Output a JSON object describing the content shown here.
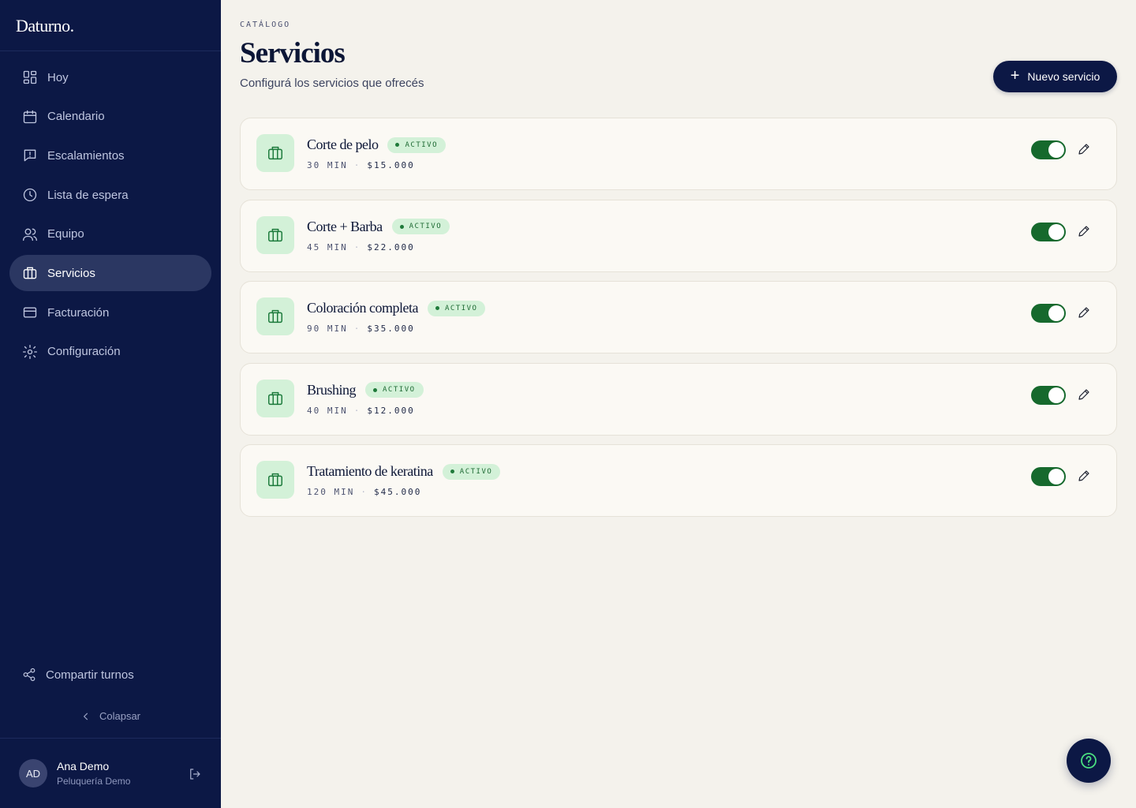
{
  "app": {
    "logo": "Daturno."
  },
  "sidebar": {
    "items": [
      {
        "label": "Hoy",
        "icon": "grid-icon",
        "active": false
      },
      {
        "label": "Calendario",
        "icon": "calendar-icon",
        "active": false
      },
      {
        "label": "Escalamientos",
        "icon": "message-alert-icon",
        "active": false
      },
      {
        "label": "Lista de espera",
        "icon": "clock-icon",
        "active": false
      },
      {
        "label": "Equipo",
        "icon": "users-icon",
        "active": false
      },
      {
        "label": "Servicios",
        "icon": "briefcase-icon",
        "active": true
      },
      {
        "label": "Facturación",
        "icon": "credit-card-icon",
        "active": false
      },
      {
        "label": "Configuración",
        "icon": "gear-icon",
        "active": false
      }
    ],
    "share_label": "Compartir turnos",
    "collapse_label": "Colapsar",
    "user": {
      "initials": "AD",
      "name": "Ana Demo",
      "org": "Peluquería Demo"
    }
  },
  "header": {
    "eyebrow": "CATÁLOGO",
    "title": "Servicios",
    "subtitle": "Configurá los servicios que ofrecés",
    "new_button": "Nuevo servicio"
  },
  "services": [
    {
      "name": "Corte de pelo",
      "status": "ACTIVO",
      "duration": "30 MIN",
      "price": "$15.000",
      "enabled": true
    },
    {
      "name": "Corte + Barba",
      "status": "ACTIVO",
      "duration": "45 MIN",
      "price": "$22.000",
      "enabled": true
    },
    {
      "name": "Coloración completa",
      "status": "ACTIVO",
      "duration": "90 MIN",
      "price": "$35.000",
      "enabled": true
    },
    {
      "name": "Brushing",
      "status": "ACTIVO",
      "duration": "40 MIN",
      "price": "$12.000",
      "enabled": true
    },
    {
      "name": "Tratamiento de keratina",
      "status": "ACTIVO",
      "duration": "120 MIN",
      "price": "$45.000",
      "enabled": true
    }
  ],
  "colors": {
    "sidebar_bg": "#0c1845",
    "accent_green": "#16692d",
    "badge_bg": "#d3f1d8",
    "page_bg": "#f4f2ec"
  }
}
